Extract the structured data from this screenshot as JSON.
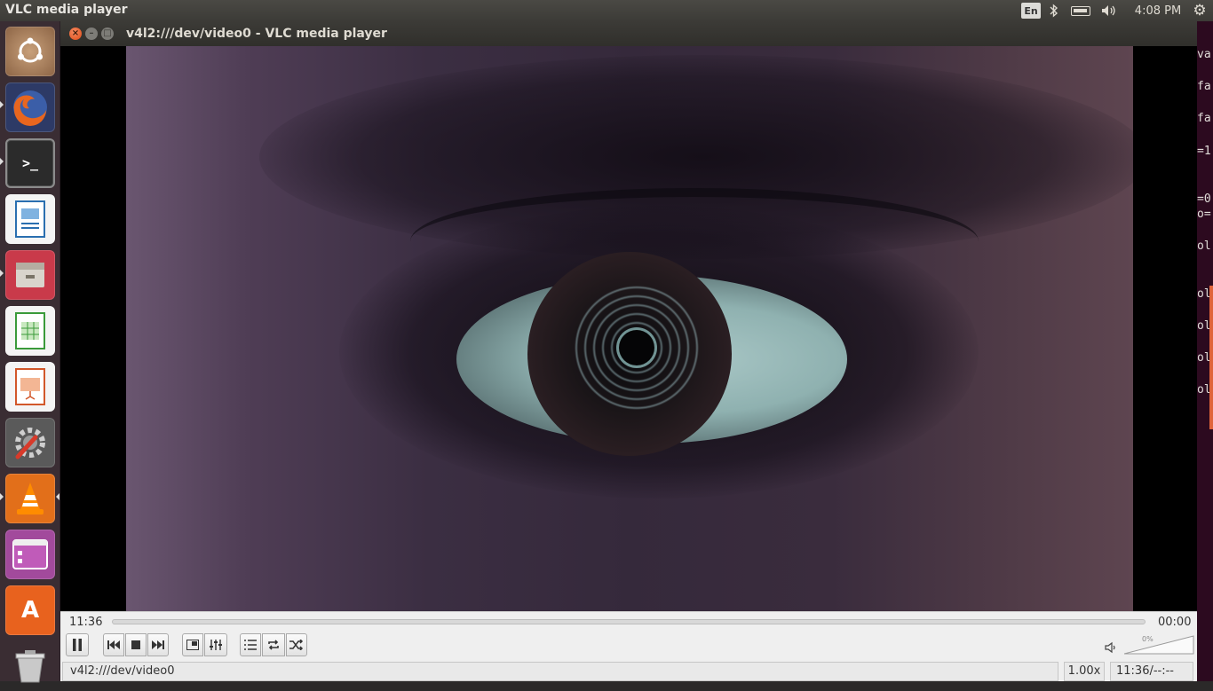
{
  "top_panel": {
    "app_title": "VLC media player",
    "lang": "En",
    "clock": "4:08 PM",
    "icons": [
      "bluetooth-icon",
      "battery-icon",
      "volume-icon",
      "gear-icon"
    ]
  },
  "launcher": {
    "items": [
      {
        "name": "ubuntu-dash",
        "label": ""
      },
      {
        "name": "firefox",
        "label": ""
      },
      {
        "name": "terminal",
        "label": ">_"
      },
      {
        "name": "libreoffice-writer",
        "label": ""
      },
      {
        "name": "file-manager",
        "label": ""
      },
      {
        "name": "libreoffice-calc",
        "label": ""
      },
      {
        "name": "libreoffice-impress",
        "label": ""
      },
      {
        "name": "system-settings",
        "label": ""
      },
      {
        "name": "vlc",
        "label": ""
      },
      {
        "name": "window-app",
        "label": ""
      },
      {
        "name": "software-center",
        "label": "A"
      },
      {
        "name": "trash",
        "label": ""
      }
    ]
  },
  "window": {
    "title": "v4l2:///dev/video0 - VLC media player"
  },
  "controls": {
    "elapsed": "11:36",
    "total": "00:00",
    "volume_pct_label": "0%",
    "volume_level": 0
  },
  "status": {
    "media": "v4l2:///dev/video0",
    "speed": "1.00x",
    "time": "11:36/--:--"
  },
  "background_terminal": {
    "lines": [
      "va",
      "fa",
      "fa",
      "=1",
      "=0",
      "o=",
      "ol",
      "ol",
      "ol",
      "ol",
      "ol"
    ]
  },
  "colors": {
    "panel": "#3c3b37",
    "launcher": "#3a2d33",
    "terminal_bg": "#2c0a1f",
    "close_button": "#df4a16",
    "controls_bg": "#efefef"
  }
}
